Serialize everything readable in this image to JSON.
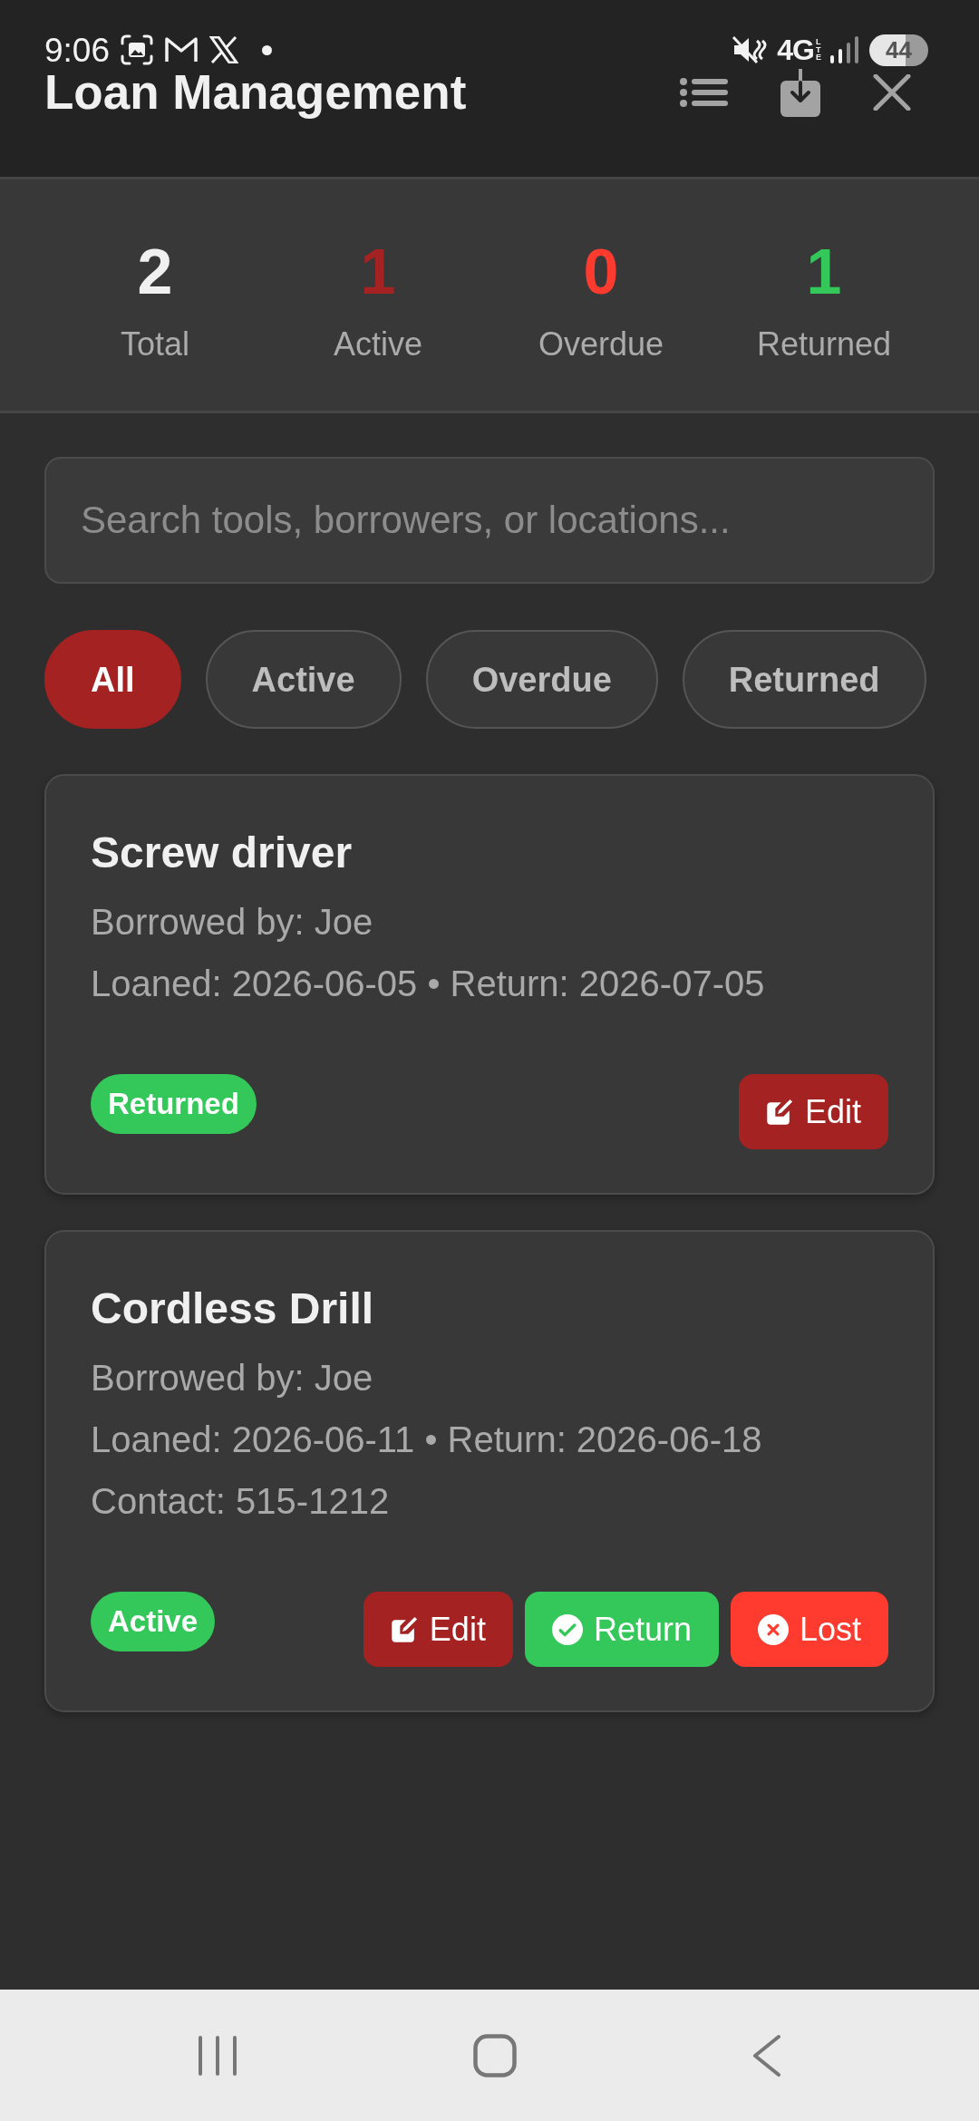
{
  "status_bar": {
    "time": "9:06",
    "network": "4G",
    "network_detail": "LTE",
    "battery": "44"
  },
  "header": {
    "title": "Loan Management"
  },
  "stats": [
    {
      "value": "2",
      "label": "Total",
      "color": "#f0f0f0"
    },
    {
      "value": "1",
      "label": "Active",
      "color": "#a52222"
    },
    {
      "value": "0",
      "label": "Overdue",
      "color": "#ff3b30"
    },
    {
      "value": "1",
      "label": "Returned",
      "color": "#34c759"
    }
  ],
  "search": {
    "placeholder": "Search tools, borrowers, or locations..."
  },
  "filters": [
    {
      "label": "All",
      "selected": true
    },
    {
      "label": "Active",
      "selected": false
    },
    {
      "label": "Overdue",
      "selected": false
    },
    {
      "label": "Returned",
      "selected": false
    }
  ],
  "loans": [
    {
      "title": "Screw driver",
      "details": [
        "Borrowed by: Joe",
        "Loaned: 2026-06-05 • Return: 2026-07-05"
      ],
      "status": {
        "label": "Returned",
        "color": "#34c759"
      },
      "actions": [
        {
          "kind": "edit",
          "label": "Edit"
        }
      ]
    },
    {
      "title": "Cordless Drill",
      "details": [
        "Borrowed by: Joe",
        "Loaned: 2026-06-11 • Return: 2026-06-18",
        "Contact: 515-1212"
      ],
      "status": {
        "label": "Active",
        "color": "#34c759"
      },
      "actions": [
        {
          "kind": "edit",
          "label": "Edit"
        },
        {
          "kind": "return",
          "label": "Return"
        },
        {
          "kind": "lost",
          "label": "Lost"
        }
      ]
    }
  ]
}
